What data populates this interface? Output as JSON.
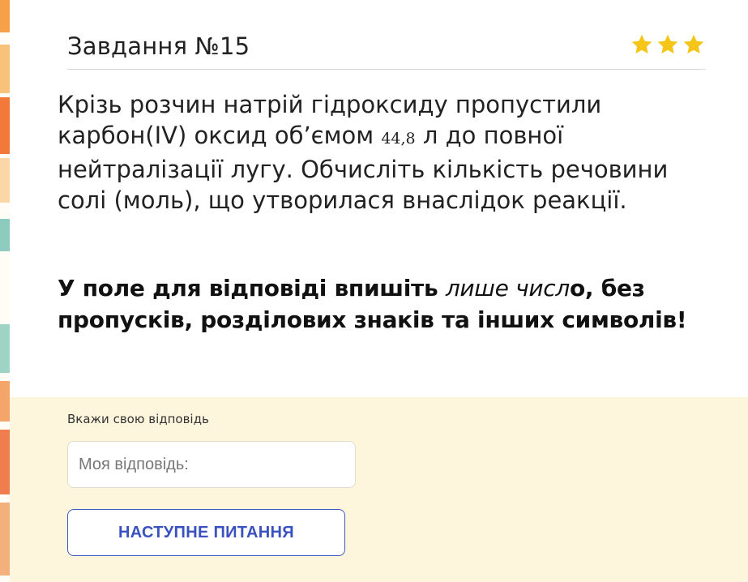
{
  "task": {
    "title": "Завдання №15",
    "difficulty_stars": 3,
    "star_color": "#f5c518"
  },
  "question": {
    "part1": "Крізь розчин натрій гідроксиду пропустили карбон(IV) оксид об’ємом",
    "volume": "44,8",
    "part2": "л до повної нейтралізації лугу. Обчисліть кількість речовини солі (моль), що утворилася внаслідок реакції."
  },
  "instruction": {
    "part1": "У поле для відповіді впишіть",
    "emphasis": "лише числ",
    "part2": "о, без пропусків, розділових знаків та інших символів!"
  },
  "answer": {
    "label": "Вкажи свою відповідь",
    "placeholder": "Моя відповідь:",
    "value": ""
  },
  "buttons": {
    "next_label": "НАСТУПНЕ ПИТАННЯ"
  },
  "colors": {
    "answer_zone_bg": "#fdf5dc",
    "button_border": "#3f58c2"
  }
}
